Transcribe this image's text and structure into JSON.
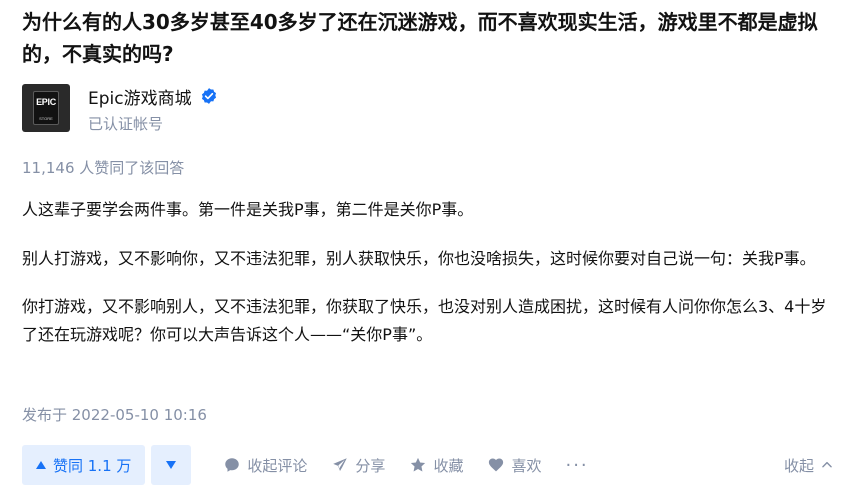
{
  "question": {
    "title": "为什么有的人30多岁甚至40多岁了还在沉迷游戏，而不喜欢现实生活，游戏里不都是虚拟的，不真实的吗?"
  },
  "author": {
    "name": "Epic游戏商城",
    "badge": "已认证帐号",
    "avatar_logo": "EPIC",
    "avatar_sub": "STORE",
    "verified_icon": "verified-check-icon",
    "verified_color": "#1772f6"
  },
  "answer": {
    "vote_count": "11,146 人赞同了该回答",
    "paragraphs": [
      "人这辈子要学会两件事。第一件是关我P事，第二件是关你P事。",
      "别人打游戏，又不影响你，又不违法犯罪，别人获取快乐，你也没啥损失，这时候你要对自己说一句：关我P事。",
      "你打游戏，又不影响别人，又不违法犯罪，你获取了快乐，也没对别人造成困扰，这时候有人问你你怎么3、4十岁了还在玩游戏呢？你可以大声告诉这个人——“关你P事”。"
    ],
    "publish_time": "发布于 2022-05-10 10:16"
  },
  "actions": {
    "vote_up_label": "赞同 1.1 万",
    "comment_label": "收起评论",
    "share_label": "分享",
    "favorite_label": "收藏",
    "like_label": "喜欢",
    "more_label": "···",
    "collapse_label": "收起",
    "accent_color": "#1772f6",
    "muted_color": "#8590a6",
    "vote_bg": "#e5effe"
  }
}
